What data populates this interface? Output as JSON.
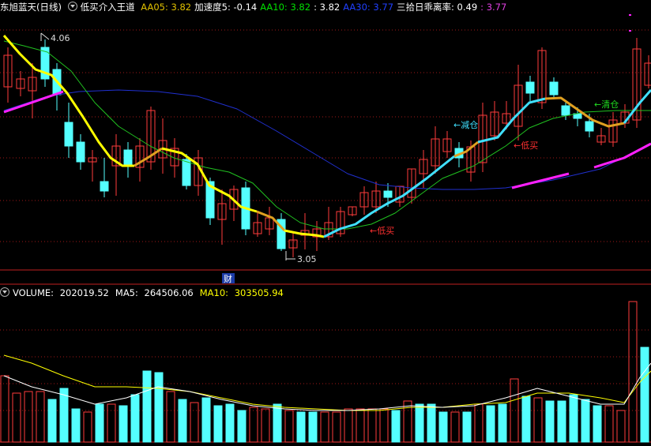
{
  "main_header": {
    "stock_name": "东旭蓝天(日线)",
    "indicator_name": "低买介入王道",
    "items": [
      {
        "label": "AA05: ",
        "value": "3.82",
        "color": "#e0c000"
      },
      {
        "label": "加速度5: ",
        "value": "-0.14",
        "color": "#ffffff"
      },
      {
        "label": "AA10: ",
        "value": "3.82",
        "color": "#00e000"
      },
      {
        "label": ": ",
        "value": "3.82",
        "color": "#ffffff"
      },
      {
        "label": "AA30: ",
        "value": "3.77",
        "color": "#2040ff"
      },
      {
        "label": "三拾日乖离率: ",
        "value": "0.49",
        "color": "#ffffff"
      },
      {
        "label": ": ",
        "value": "3.77",
        "color": "#e040e0"
      }
    ]
  },
  "annotations": {
    "high": "4.06",
    "low": "3.05",
    "low_buy_1": "←低买",
    "low_buy_2": "←低买",
    "reduce": "←减仓",
    "clear": "←清仓",
    "finance_badge": "财"
  },
  "volume_header": {
    "label": "VOLUME: ",
    "value": "202019.52",
    "ma5_label": "MA5: ",
    "ma5_value": "264506.06",
    "ma10_label": "MA10: ",
    "ma10_value": "303505.94"
  },
  "colors": {
    "up": "#ff3c3c",
    "down": "#54ffff",
    "aa05": "#ffff00",
    "aa05_alt": "#e0a020",
    "aa05_cyan": "#40e0ff",
    "aa10": "#20c020",
    "aa30": "#2030d0",
    "magenta": "#ff20ff",
    "grid": "#a01818",
    "vol_ma5": "#ffffff",
    "vol_ma10": "#ffff00"
  }
}
